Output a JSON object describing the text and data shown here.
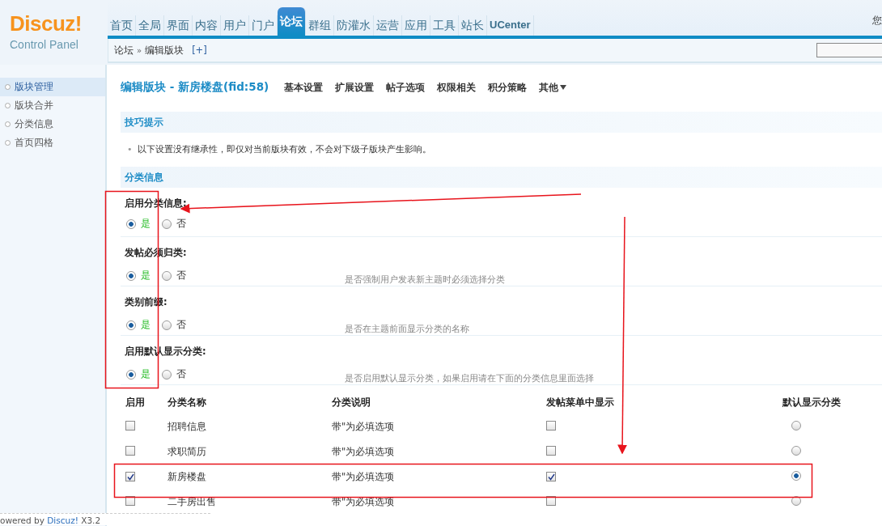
{
  "logo": {
    "brand": "Discuz!",
    "subtitle": "Control Panel"
  },
  "nav": [
    {
      "label": "首页",
      "selected": false
    },
    {
      "label": "全局",
      "selected": false
    },
    {
      "label": "界面",
      "selected": false
    },
    {
      "label": "内容",
      "selected": false
    },
    {
      "label": "用户",
      "selected": false
    },
    {
      "label": "门户",
      "selected": false
    },
    {
      "label": "论坛",
      "selected": true
    },
    {
      "label": "群组",
      "selected": false
    },
    {
      "label": "防灌水",
      "selected": false
    },
    {
      "label": "运营",
      "selected": false
    },
    {
      "label": "应用",
      "selected": false
    },
    {
      "label": "工具",
      "selected": false
    },
    {
      "label": "站长",
      "selected": false
    },
    {
      "label": "UCenter",
      "selected": false
    }
  ],
  "greeting": "您",
  "breadcrumb": {
    "items": [
      "论坛",
      "编辑版块"
    ],
    "separator": "»",
    "add": "[+]"
  },
  "sidebar": {
    "items": [
      {
        "label": "版块管理",
        "selected": true
      },
      {
        "label": "版块合并",
        "selected": false
      },
      {
        "label": "分类信息",
        "selected": false
      },
      {
        "label": "首页四格",
        "selected": false
      }
    ]
  },
  "footer": {
    "prefix": "owered by ",
    "link": "Discuz!",
    "version": " X3.2"
  },
  "page": {
    "title": "编辑版块 - 新房楼盘(fid:58)",
    "tabs": [
      "基本设置",
      "扩展设置",
      "帖子选项",
      "权限相关",
      "积分策略"
    ],
    "more": "其他"
  },
  "tips": {
    "heading": "技巧提示",
    "bullet": "•",
    "text": "以下设置没有继承性，即仅对当前版块有效，不会对下级子版块产生影响。"
  },
  "section": {
    "heading": "分类信息",
    "settings": [
      {
        "label": "启用分类信息:",
        "options": [
          {
            "label": "是",
            "selected": true
          },
          {
            "label": "否",
            "selected": false
          }
        ]
      },
      {
        "label": "发帖必须归类:",
        "options": [
          {
            "label": "是",
            "selected": true
          },
          {
            "label": "否",
            "selected": false
          }
        ],
        "description": "是否强制用户发表新主题时必须选择分类"
      },
      {
        "label": "类别前缀:",
        "options": [
          {
            "label": "是",
            "selected": true
          },
          {
            "label": "否",
            "selected": false
          }
        ],
        "description": "是否在主题前面显示分类的名称"
      },
      {
        "label": "启用默认显示分类:",
        "options": [
          {
            "label": "是",
            "selected": true
          },
          {
            "label": "否",
            "selected": false
          }
        ],
        "description": "是否启用默认显示分类，如果启用请在下面的分类信息里面选择"
      }
    ]
  },
  "table": {
    "columns": [
      "启用",
      "分类名称",
      "分类说明",
      "发帖菜单中显示",
      "默认显示分类"
    ],
    "rows": [
      {
        "enabled": false,
        "name": "招聘信息",
        "note": "带\"为必填选项",
        "in_menu": false,
        "selected": false
      },
      {
        "enabled": false,
        "name": "求职简历",
        "note": "带\"为必填选项",
        "in_menu": false,
        "selected": false
      },
      {
        "enabled": true,
        "name": "新房楼盘",
        "note": "带\"为必填选项",
        "in_menu": true,
        "selected": true
      },
      {
        "enabled": false,
        "name": "二手房出售",
        "note": "带\"为必填选项",
        "in_menu": false,
        "selected": false
      }
    ]
  }
}
